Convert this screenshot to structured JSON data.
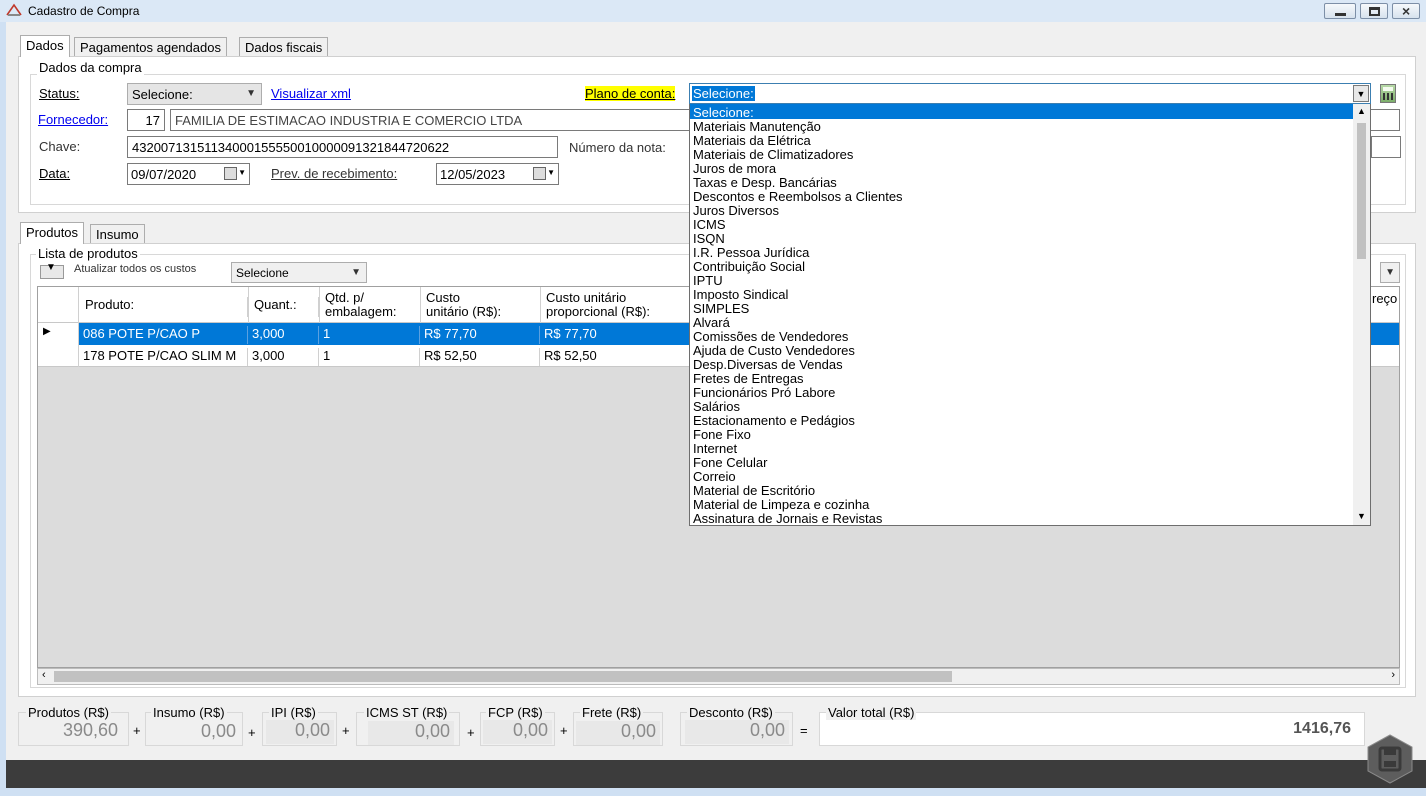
{
  "window": {
    "title": "Cadastro de Compra"
  },
  "tabs": [
    "Dados",
    "Pagamentos agendados",
    "Dados fiscais"
  ],
  "dados_compra": {
    "title": "Dados da compra",
    "status_label": "Status:",
    "status_value": "Selecione:",
    "visualizar_xml": "Visualizar xml",
    "plano_label": "Plano de conta:",
    "plano_value": "Selecione:",
    "fornecedor_label": "Fornecedor:",
    "fornecedor_id": "17",
    "fornecedor_name": "FAMILIA DE ESTIMACAO INDUSTRIA E COMERCIO LTDA",
    "chave_label": "Chave:",
    "chave_value": "43200713151134000155550010000091321844720622",
    "numero_label": "Número da nota:",
    "data_label": "Data:",
    "data_value": "09/07/2020",
    "prev_label": "Prev. de recebimento:",
    "prev_value": "12/05/2023"
  },
  "product_tabs": [
    "Produtos",
    "Insumo"
  ],
  "lista": {
    "title": "Lista de produtos",
    "atualizar_label": "Atualizar todos os custos",
    "select_value": "Selecione",
    "headers": {
      "produto": "Produto:",
      "quant": "Quant.:",
      "qtd_line1": "Qtd. p/",
      "qtd_line2": "embalagem:",
      "custo_line1": "Custo",
      "custo_line2": "unitário (R$):",
      "custop_line1": "Custo unitário",
      "custop_line2": "proporcional (R$):",
      "preco_partial": "reço"
    },
    "rows": [
      {
        "produto": "086 POTE P/CAO P",
        "quant": "3,000",
        "qtd": "1",
        "custo": "R$ 77,70",
        "custo_prop": "R$ 77,70",
        "selected": true
      },
      {
        "produto": "178 POTE P/CAO SLIM M",
        "quant": "3,000",
        "qtd": "1",
        "custo": "R$ 52,50",
        "custo_prop": "R$ 52,50",
        "selected": false
      }
    ]
  },
  "dropdown_options": [
    "Selecione:",
    "Materiais Manutenção",
    "Materiais da Elétrica",
    "Materiais de Climatizadores",
    "Juros de mora",
    "Taxas e Desp. Bancárias",
    "Descontos e Reembolsos a Clientes",
    "Juros Diversos",
    "ICMS",
    "ISQN",
    "I.R. Pessoa Jurídica",
    "Contribuição Social",
    "IPTU",
    "Imposto Sindical",
    "SIMPLES",
    "Alvará",
    "Comissões de Vendedores",
    "Ajuda de Custo Vendedores",
    "Desp.Diversas de Vendas",
    "Fretes de Entregas",
    "Funcionários Pró Labore",
    "Salários",
    "Estacionamento e Pedágios",
    "Fone Fixo",
    "Internet",
    "Fone Celular",
    "Correio",
    "Material de Escritório",
    "Material de Limpeza e cozinha",
    "Assinatura de Jornais e Revistas"
  ],
  "totals": {
    "produtos_label": "Produtos (R$)",
    "produtos_value": "390,60",
    "insumo_label": "Insumo (R$)",
    "insumo_value": "0,00",
    "ipi_label": "IPI (R$)",
    "ipi_value": "0,00",
    "icmsst_label": "ICMS ST (R$)",
    "icmsst_value": "0,00",
    "fcp_label": "FCP (R$)",
    "fcp_value": "0,00",
    "frete_label": "Frete (R$)",
    "frete_value": "0,00",
    "desconto_label": "Desconto (R$)",
    "desconto_value": "0,00",
    "valor_label": "Valor total (R$)",
    "valor_value": "1416,76",
    "plus": "+",
    "equals": "="
  },
  "colors": {
    "selection": "#0078d7",
    "highlight": "#ffff00",
    "link": "#0000ee"
  }
}
